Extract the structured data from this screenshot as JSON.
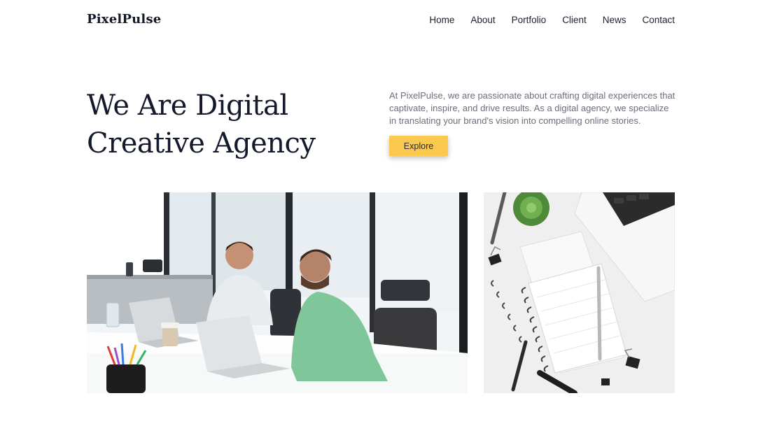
{
  "brand": {
    "name": "PixelPulse"
  },
  "nav": {
    "items": [
      "Home",
      "About",
      "Portfolio",
      "Client",
      "News",
      "Contact"
    ]
  },
  "hero": {
    "title_line1": "We Are Digital",
    "title_line2": "Creative Agency",
    "description": "At PixelPulse, we are passionate about crafting digital experiences that captivate, inspire, and drive results. As a digital agency, we specialize in translating your brand's vision into compelling online stories.",
    "cta_label": "Explore"
  },
  "colors": {
    "accent": "#fbc94e",
    "heading": "#141a2c",
    "body_text": "#6b6f7a"
  },
  "images": {
    "office": "two-men-working-on-laptops-photo",
    "desk": "desk-flatlay-notebook-photo"
  }
}
